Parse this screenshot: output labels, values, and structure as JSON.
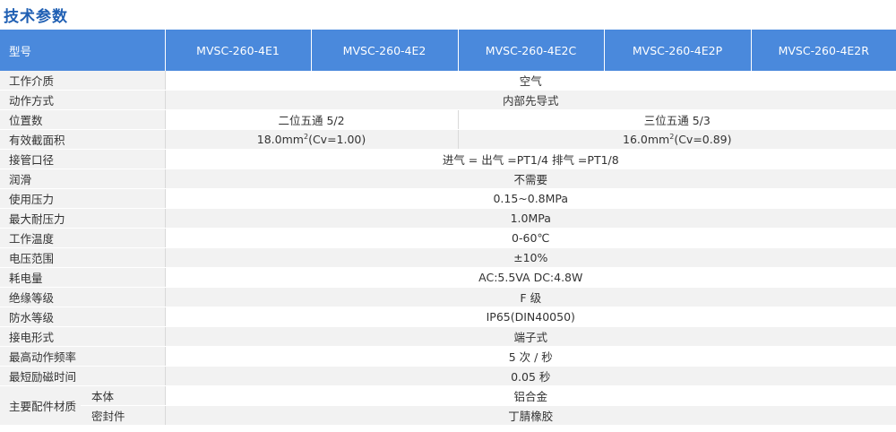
{
  "title": "技术参数",
  "header": {
    "label": "型号",
    "models": [
      "MVSC-260-4E1",
      "MVSC-260-4E2",
      "MVSC-260-4E2C",
      "MVSC-260-4E2P",
      "MVSC-260-4E2R"
    ]
  },
  "rows": {
    "medium": {
      "label": "工作介质",
      "value": "空气"
    },
    "action": {
      "label": "动作方式",
      "value": "内部先导式"
    },
    "positions": {
      "label": "位置数",
      "left": "二位五通 5/2",
      "right": "三位五通 5/3"
    },
    "area": {
      "label": "有效截面积",
      "left": "18.0mm",
      "left_sup": "2",
      "left_tail": "(Cv=1.00)",
      "right": "16.0mm",
      "right_sup": "2",
      "right_tail": "(Cv=0.89)"
    },
    "port": {
      "label": "接管口径",
      "value": "进气 = 出气 =PT1/4  排气 =PT1/8"
    },
    "lube": {
      "label": "润滑",
      "value": "不需要"
    },
    "pressure": {
      "label": "使用压力",
      "value": "0.15~0.8MPa"
    },
    "max_pressure": {
      "label": "最大耐压力",
      "value": "1.0MPa"
    },
    "temp": {
      "label": "工作温度",
      "value": "0-60℃"
    },
    "voltage": {
      "label": "电压范围",
      "value": "±10%"
    },
    "power": {
      "label": "耗电量",
      "value": "AC:5.5VA DC:4.8W"
    },
    "insulation": {
      "label": "绝缘等级",
      "value": "F 级"
    },
    "waterproof": {
      "label": "防水等级",
      "value": "IP65(DIN40050)"
    },
    "connection": {
      "label": "接电形式",
      "value": "端子式"
    },
    "frequency": {
      "label": "最高动作频率",
      "value": "5 次 / 秒"
    },
    "excite": {
      "label": "最短励磁时间",
      "value": "0.05 秒"
    },
    "material": {
      "label": "主要配件材质",
      "body_label": "本体",
      "body_value": "铝合金",
      "seal_label": "密封件",
      "seal_value": "丁腈橡胶"
    }
  }
}
